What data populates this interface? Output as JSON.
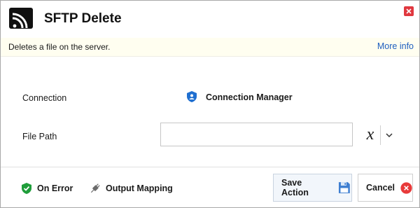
{
  "header": {
    "title": "SFTP Delete"
  },
  "infobar": {
    "description": "Deletes a file on the server.",
    "more_info": "More info"
  },
  "form": {
    "connection": {
      "label": "Connection",
      "value": "Connection Manager"
    },
    "file_path": {
      "label": "File Path",
      "value": ""
    },
    "expression_glyph": "x"
  },
  "footer": {
    "on_error": "On Error",
    "output_mapping": "Output Mapping",
    "save_action": "Save Action",
    "cancel": "Cancel"
  },
  "colors": {
    "close_red": "#e0383f",
    "link_blue": "#1f5fbf",
    "info_bg": "#fffef0",
    "shield_green": "#1f9d3a",
    "shield_blue": "#1f6fd0",
    "save_icon_blue": "#3f7fd1",
    "cancel_red": "#e83a3a"
  },
  "icons": {
    "app": "sftp-signal-icon",
    "connection": "connection-shield-icon",
    "on_error": "shield-check-icon",
    "output_mapping": "plug-icon",
    "save": "floppy-disk-icon",
    "cancel": "close-circle-icon",
    "dropdown": "chevron-down-icon"
  }
}
